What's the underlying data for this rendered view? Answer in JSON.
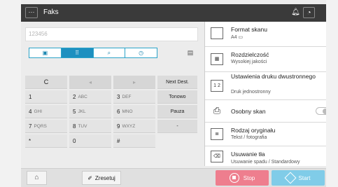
{
  "topbar": {
    "title": "Faks",
    "menu_icon": "ellipsis-icon",
    "bell_icon": "bell-icon",
    "user_icon": "user-icon"
  },
  "destination": {
    "value": "123456"
  },
  "address_tabs": [
    {
      "name": "address-book-icon",
      "glyph": "▣"
    },
    {
      "name": "keypad-icon",
      "glyph": "⠿"
    },
    {
      "name": "search-icon",
      "glyph": "⌕"
    },
    {
      "name": "history-icon",
      "glyph": "◷"
    }
  ],
  "address_register_icon": "address-register-icon",
  "keypad": {
    "c": "C",
    "next_dest": "Next Dest.",
    "keys": [
      {
        "main": "1",
        "sub": ""
      },
      {
        "main": "2",
        "sub": "ABC"
      },
      {
        "main": "3",
        "sub": "DEF"
      },
      {
        "main": "4",
        "sub": "GHI"
      },
      {
        "main": "5",
        "sub": "JKL"
      },
      {
        "main": "6",
        "sub": "MNO"
      },
      {
        "main": "7",
        "sub": "PQRS"
      },
      {
        "main": "8",
        "sub": "TUV"
      },
      {
        "main": "9",
        "sub": "WXYZ"
      },
      {
        "main": "*",
        "sub": ""
      },
      {
        "main": "0",
        "sub": ""
      },
      {
        "main": "#",
        "sub": ""
      }
    ],
    "tonowo": "Tonowo",
    "pauza": "Pauza",
    "dash": "-"
  },
  "settings": {
    "scan_format": {
      "label": "Format skanu",
      "value": "A4"
    },
    "resolution": {
      "label": "Rozdzielczość",
      "value": "Wysokiej jakości"
    },
    "duplex": {
      "label": "Ustawienia druku dwustronnego",
      "value": "Druk jednostronny"
    },
    "separate": {
      "label": "Osobny skan"
    },
    "original_type": {
      "label": "Rodzaj oryginału",
      "value": "Tekst / fotografia"
    },
    "erase": {
      "label": "Usuwanie tła",
      "value": "Usuwanie spadu / Standardowy"
    }
  },
  "bottombar": {
    "reset": "Zresetuj",
    "stop": "Stop",
    "start": "Start"
  },
  "colors": {
    "accent": "#1e90c0",
    "stop": "#ee7e8e",
    "start": "#80cce8",
    "topbar": "#3a3a3a"
  }
}
